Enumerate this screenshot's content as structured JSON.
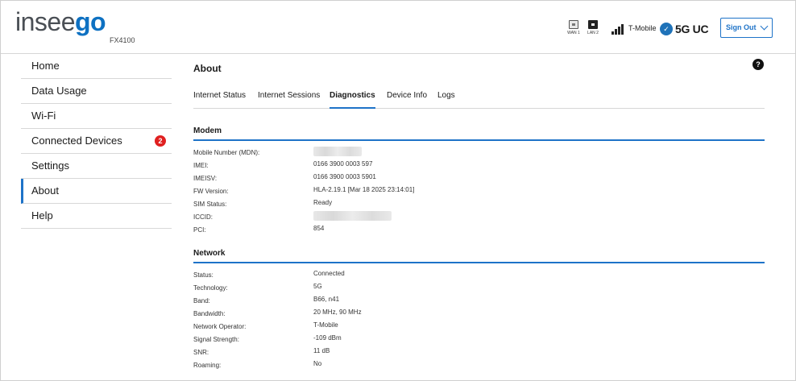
{
  "header": {
    "logo_part1": "insee",
    "logo_part2": "go",
    "model": "FX4100",
    "ports": [
      {
        "label": "WAN 1",
        "state": "inactive"
      },
      {
        "label": "LAN 2",
        "state": "active"
      }
    ],
    "signal_icon": "signal-bars-icon",
    "carrier": "T-Mobile",
    "network_icon": "5g-uc-badge-icon",
    "technology_label": "5G UC",
    "sign_out_label": "Sign Out"
  },
  "sidebar": {
    "items": [
      {
        "label": "Home",
        "active": false
      },
      {
        "label": "Data Usage",
        "active": false
      },
      {
        "label": "Wi-Fi",
        "active": false
      },
      {
        "label": "Connected Devices",
        "active": false,
        "badge": "2"
      },
      {
        "label": "Settings",
        "active": false
      },
      {
        "label": "About",
        "active": true
      },
      {
        "label": "Help",
        "active": false
      }
    ]
  },
  "main": {
    "title": "About",
    "help_icon": "?",
    "tabs": [
      {
        "label": "Internet Status",
        "active": false
      },
      {
        "label": "Internet Sessions",
        "active": false
      },
      {
        "label": "Diagnostics",
        "active": true
      },
      {
        "label": "Device Info",
        "active": false
      },
      {
        "label": "Logs",
        "active": false
      }
    ],
    "modem": {
      "title": "Modem",
      "rows": [
        {
          "label": "Mobile Number (MDN):",
          "value": "",
          "redacted": true
        },
        {
          "label": "IMEI:",
          "value": "0166 3900 0003 597"
        },
        {
          "label": "IMEISV:",
          "value": "0166 3900 0003 5901"
        },
        {
          "label": "FW Version:",
          "value": "HLA-2.19.1 [Mar 18 2025 23:14:01]"
        },
        {
          "label": "SIM Status:",
          "value": "Ready"
        },
        {
          "label": "ICCID:",
          "value": "",
          "redacted": true
        },
        {
          "label": "PCI:",
          "value": "854"
        }
      ]
    },
    "network": {
      "title": "Network",
      "rows": [
        {
          "label": "Status:",
          "value": "Connected"
        },
        {
          "label": "Technology:",
          "value": "5G"
        },
        {
          "label": "Band:",
          "value": "B66, n41"
        },
        {
          "label": "Bandwidth:",
          "value": "20 MHz, 90 MHz"
        },
        {
          "label": "Network Operator:",
          "value": "T-Mobile"
        },
        {
          "label": "Signal Strength:",
          "value": "-109 dBm"
        },
        {
          "label": "SNR:",
          "value": "11 dB"
        },
        {
          "label": "Roaming:",
          "value": "No"
        }
      ]
    }
  },
  "colors": {
    "accent": "#1e73c8",
    "logo_gray": "#4a4f55",
    "logo_blue": "#0e71c2",
    "badge_red": "#e02020"
  }
}
